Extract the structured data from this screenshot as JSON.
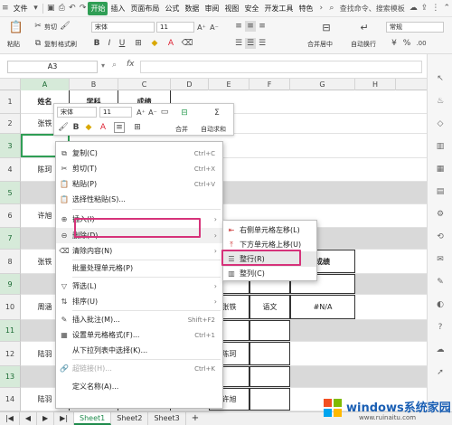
{
  "menubar": {
    "file": "文件",
    "tabs": [
      "开始",
      "插入",
      "页面布局",
      "公式",
      "数据",
      "审阅",
      "视图",
      "安全",
      "开发工具",
      "特色"
    ],
    "active_tab": "开始",
    "search": "查找命令、搜索模板"
  },
  "ribbon": {
    "paste": "粘贴",
    "cut": "剪切",
    "copy": "复制",
    "format_painter": "格式刷",
    "font_name": "宋体",
    "font_size": "11",
    "merge_center": "合并居中",
    "wrap": "自动换行",
    "number_format": "常规",
    "accent_color": "#2f9e55"
  },
  "formula_bar": {
    "name_box": "A3",
    "fx": "fx"
  },
  "columns": [
    "A",
    "B",
    "C",
    "D",
    "E",
    "F",
    "G",
    "H"
  ],
  "rows": [
    "1",
    "2",
    "3",
    "4",
    "5",
    "6",
    "7",
    "8",
    "9",
    "10",
    "11",
    "12",
    "13",
    "14"
  ],
  "cells": {
    "a1": "姓名",
    "b1": "学科",
    "c1": "成绩",
    "a2": "张铁",
    "a4": "陈珂",
    "a6": "许旭",
    "a8": "张铁",
    "a10": "周涵",
    "a12": "陆羽",
    "a14": "陆羽",
    "b14": "语文",
    "c14": "90",
    "g8": "成绩",
    "e10": "张铁",
    "f10": "语文",
    "g10": "#N/A",
    "e12": "陈珂",
    "e14": "许旭"
  },
  "mini_toolbar": {
    "font_name": "宋体",
    "font_size": "11",
    "merge": "合并",
    "autosum": "自动求和"
  },
  "context_menu": [
    {
      "label": "复制(C)",
      "shortcut": "Ctrl+C",
      "icon": "copy-icon"
    },
    {
      "label": "剪切(T)",
      "shortcut": "Ctrl+X",
      "icon": "cut-icon"
    },
    {
      "label": "粘贴(P)",
      "shortcut": "Ctrl+V",
      "icon": "paste-icon"
    },
    {
      "label": "选择性粘贴(S)...",
      "shortcut": "",
      "icon": "paste-special-icon"
    },
    {
      "label": "插入(I)",
      "shortcut": "",
      "icon": "insert-icon"
    },
    {
      "label": "删除(D)",
      "shortcut": "",
      "icon": "delete-icon"
    },
    {
      "label": "清除内容(N)",
      "shortcut": "",
      "icon": "clear-icon"
    },
    {
      "label": "批量处理单元格(P)",
      "shortcut": "",
      "icon": "batch-icon"
    },
    {
      "label": "筛选(L)",
      "shortcut": "",
      "icon": "filter-icon"
    },
    {
      "label": "排序(U)",
      "shortcut": "",
      "icon": "sort-icon"
    },
    {
      "label": "插入批注(M)...",
      "shortcut": "Shift+F2",
      "icon": "comment-icon"
    },
    {
      "label": "设置单元格格式(F)...",
      "shortcut": "Ctrl+1",
      "icon": "format-cells-icon"
    },
    {
      "label": "从下拉列表中选择(K)...",
      "shortcut": "",
      "icon": "dropdown-icon"
    },
    {
      "label": "超链接(H)...",
      "shortcut": "Ctrl+K",
      "icon": "hyperlink-icon"
    },
    {
      "label": "定义名称(A)...",
      "shortcut": "",
      "icon": "define-name-icon"
    }
  ],
  "submenu": [
    {
      "label": "右侧单元格左移(L)",
      "icon": "shift-left-icon"
    },
    {
      "label": "下方单元格上移(U)",
      "icon": "shift-up-icon"
    },
    {
      "label": "整行(R)",
      "icon": "delete-row-icon"
    },
    {
      "label": "整列(C)",
      "icon": "delete-column-icon"
    }
  ],
  "sheet_tabs": [
    "Sheet1",
    "Sheet2",
    "Sheet3"
  ],
  "active_sheet": "Sheet1",
  "add_sheet": "+",
  "watermark": {
    "text": "windows系统家园",
    "url": "www.ruinaitu.com"
  },
  "highlight_color": "#d6337a"
}
